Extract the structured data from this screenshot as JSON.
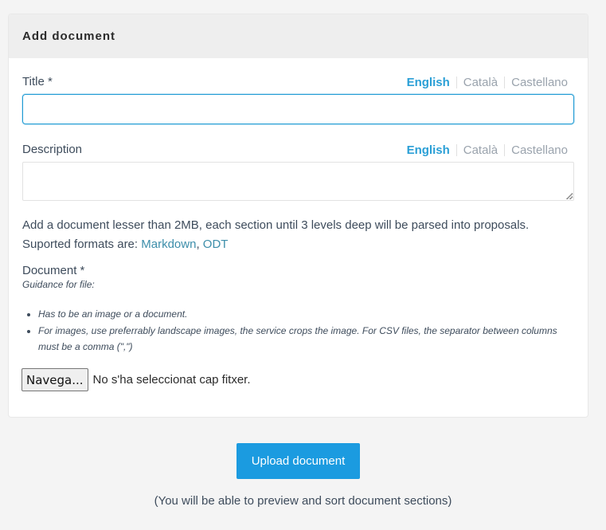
{
  "card": {
    "title": "Add document"
  },
  "title_field": {
    "label": "Title *",
    "value": "",
    "languages": [
      "English",
      "Català",
      "Castellano"
    ],
    "active_language": "English"
  },
  "description_field": {
    "label": "Description",
    "value": "",
    "languages": [
      "English",
      "Català",
      "Castellano"
    ],
    "active_language": "English"
  },
  "help": {
    "line1": "Add a document lesser than 2MB, each section until 3 levels deep will be parsed into proposals.",
    "line2_prefix": "Suported formats are: ",
    "format1": "Markdown",
    "separator": ", ",
    "format2": "ODT"
  },
  "document_field": {
    "label": "Document *",
    "guidance_title": "Guidance for file:",
    "guidance_items": [
      "Has to be an image or a document.",
      "For images, use preferrably landscape images, the service crops the image. For CSV files, the separator between columns must be a comma (\",\")"
    ],
    "browse_label": "Navega...",
    "file_status": "No s'ha seleccionat cap fitxer."
  },
  "upload": {
    "label": "Upload document",
    "footnote": "(You will be able to preview and sort document sections)"
  },
  "colors": {
    "accent": "#1b9be0",
    "link": "#3d8eaa",
    "active_lang": "#2a9fd6",
    "inactive_lang": "#9aa3ad"
  }
}
